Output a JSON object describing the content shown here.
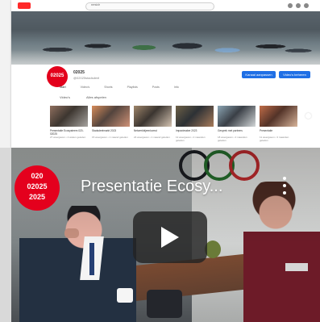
{
  "top_preview": {
    "search_text": "nesidr",
    "channel_name": "02025",
    "channel_meta": "@02025stadsdeel",
    "buttons": [
      "Kanaal aanpassen",
      "Video's beheren"
    ],
    "tabs": [
      "Start",
      "Video's",
      "Shorts",
      "Playlists",
      "Posts",
      "Info"
    ],
    "subbar": {
      "title": "Video's",
      "play_all": "Alles afspelen"
    },
    "thumbs": [
      {
        "title": "Presentatie Ecosysteem 020-02025",
        "meta": "27 weergaven • 2 weken geleden"
      },
      {
        "title": "Stadsdeelmarkt 2023",
        "meta": "15 weergaven • 1 maand geleden"
      },
      {
        "title": "Netwerkbijeenkomst",
        "meta": "24 weergaven • 1 maand geleden"
      },
      {
        "title": "Impactmaker 2023",
        "meta": "12 weergaven • 2 maanden geleden"
      },
      {
        "title": "Gesprek met partners",
        "meta": "18 weergaven • 2 maanden geleden"
      },
      {
        "title": "Presentatie",
        "meta": "11 weergaven • 3 maanden geleden"
      }
    ]
  },
  "video": {
    "logo_lines": [
      "020",
      "02025",
      "2025"
    ],
    "title": "Presentatie Ecosy..."
  }
}
